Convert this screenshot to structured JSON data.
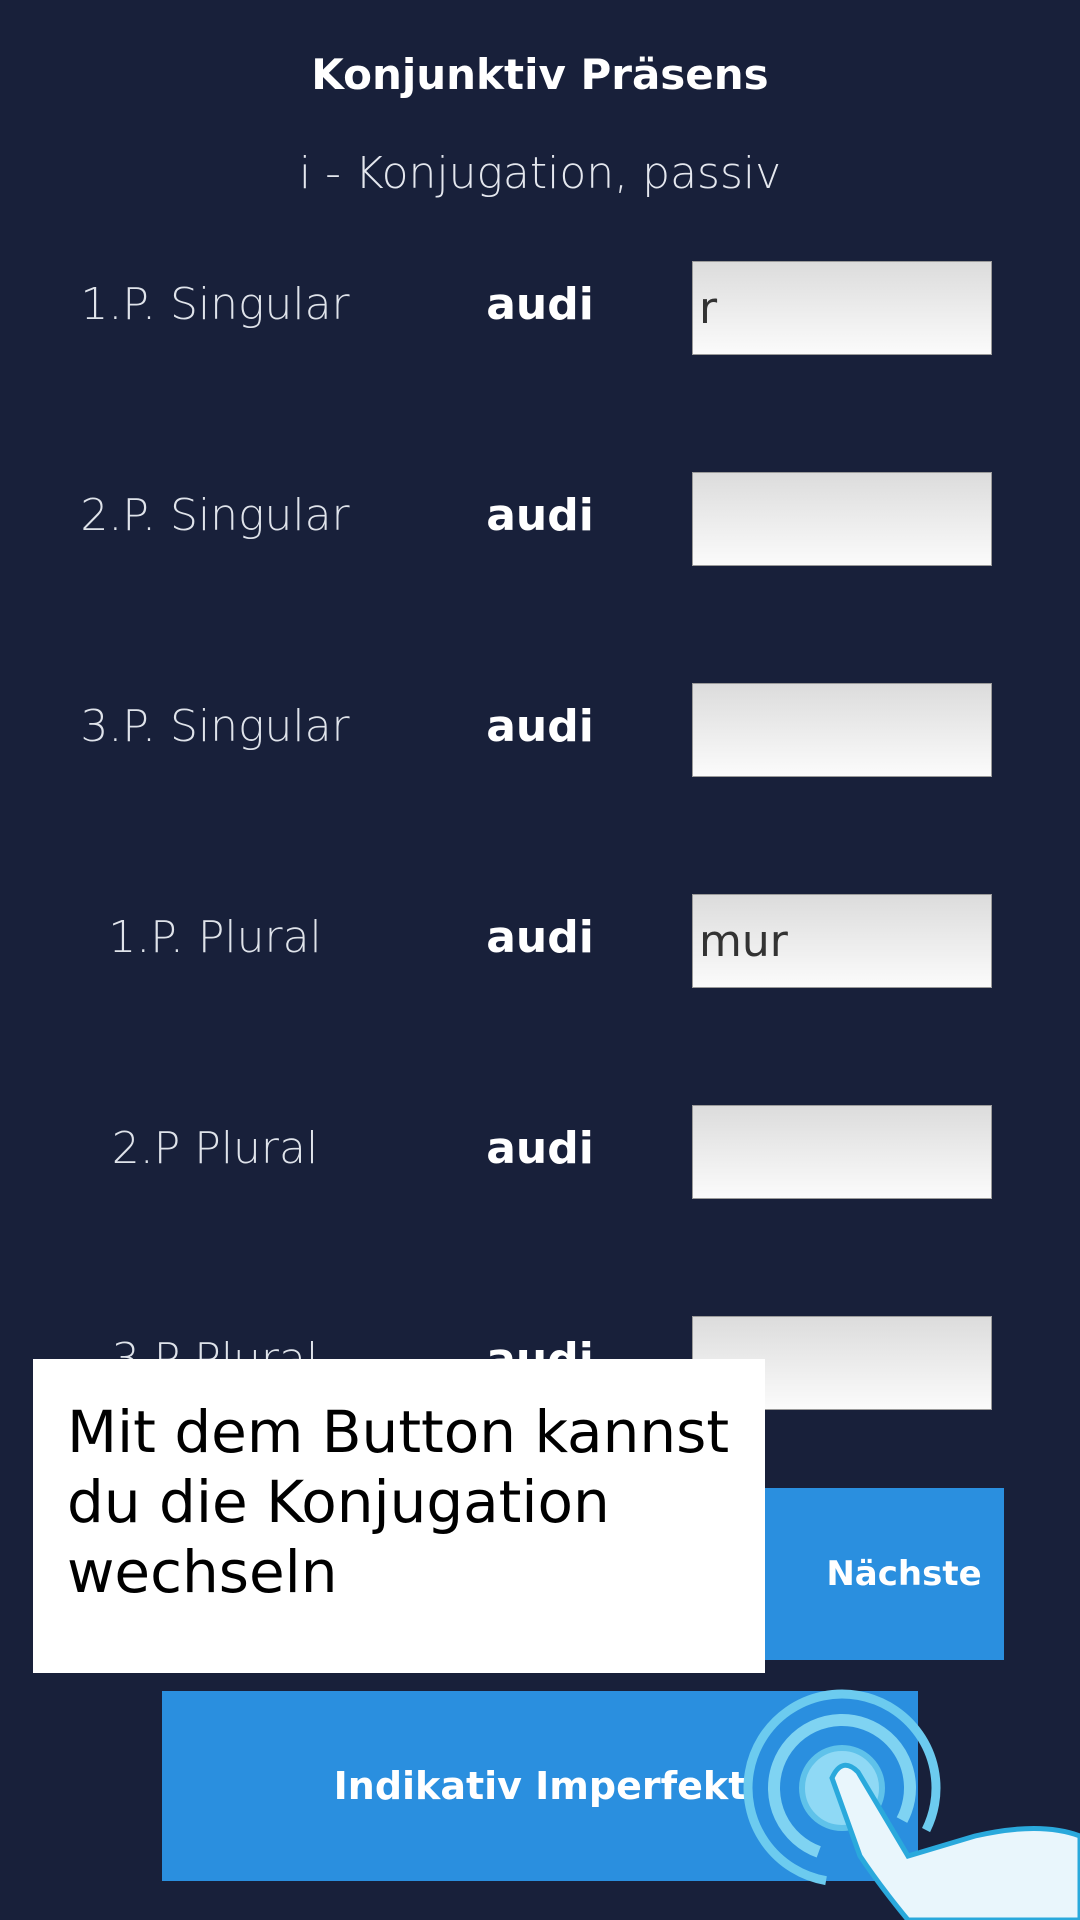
{
  "header": {
    "title": "Konjunktiv Präsens",
    "subtitle": "i - Konjugation, passiv"
  },
  "rows": [
    {
      "label": "1.P. Singular",
      "stem": "audi",
      "value": "r"
    },
    {
      "label": "2.P. Singular",
      "stem": "audi",
      "value": ""
    },
    {
      "label": "3.P. Singular",
      "stem": "audi",
      "value": ""
    },
    {
      "label": "1.P. Plural",
      "stem": "audi",
      "value": "mur"
    },
    {
      "label": "2.P Plural",
      "stem": "audi",
      "value": ""
    },
    {
      "label": "3.P Plural",
      "stem": "audi",
      "value": ""
    }
  ],
  "buttons": {
    "next_label": "Nächste",
    "mode_label": "Indikativ Imperfekt"
  },
  "tooltip": {
    "text": "Mit dem Button kannst du die Konjugation wechseln"
  },
  "icons": {
    "tap_hint": "tap-hand-icon"
  },
  "colors": {
    "background": "#18203a",
    "accent": "#2a8fdf"
  }
}
